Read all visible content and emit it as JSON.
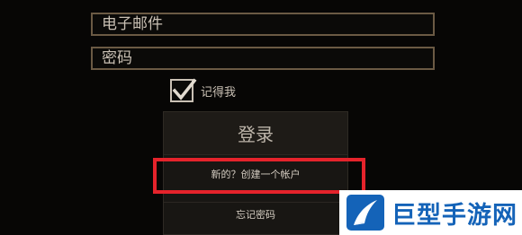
{
  "form": {
    "email_placeholder": "电子邮件",
    "password_placeholder": "密码",
    "remember_label": "记得我",
    "remember_checked": true
  },
  "actions": {
    "login_label": "登录",
    "create_account_label": "新的？创建一个帐户",
    "forgot_password_label": "忘记密码"
  },
  "watermark": {
    "text": "巨型手游网"
  },
  "colors": {
    "background": "#070605",
    "field_border": "#6b5a44",
    "panel": "#181613",
    "highlight": "#e5232b",
    "watermark_blue": "#1463b8"
  }
}
